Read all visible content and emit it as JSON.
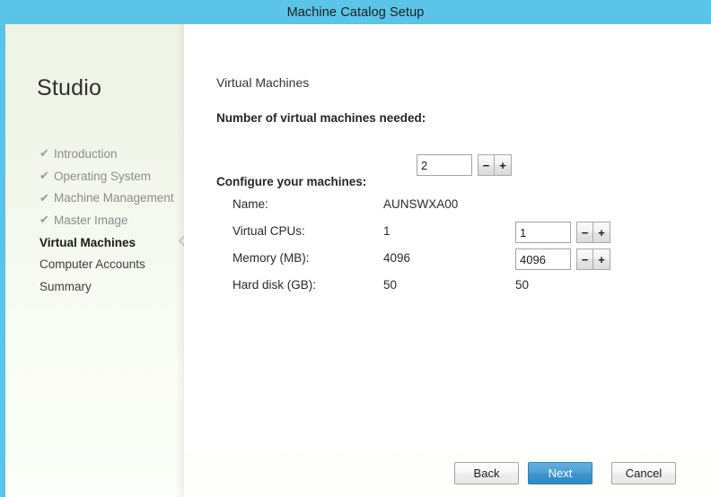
{
  "window": {
    "title": "Machine Catalog Setup"
  },
  "sidebar": {
    "product_title": "Studio",
    "items": [
      {
        "label": "Introduction",
        "state": "done",
        "check": "✔"
      },
      {
        "label": "Operating System",
        "state": "done",
        "check": "✔"
      },
      {
        "label": "Machine Management",
        "state": "done",
        "check": "✔"
      },
      {
        "label": "Master Image",
        "state": "done",
        "check": "✔"
      },
      {
        "label": "Virtual Machines",
        "state": "current",
        "check": ""
      },
      {
        "label": "Computer Accounts",
        "state": "pending",
        "check": ""
      },
      {
        "label": "Summary",
        "state": "pending",
        "check": ""
      }
    ]
  },
  "main": {
    "heading": "Virtual Machines",
    "vm_count": {
      "label": "Number of virtual machines needed:",
      "value": "2",
      "decrement_label": "−",
      "increment_label": "+"
    },
    "configure": {
      "label": "Configure your machines:",
      "rows": [
        {
          "name": "Name:",
          "value": "AUNSWXA00",
          "control": "none",
          "control_value": "",
          "control_text": ""
        },
        {
          "name": "Virtual CPUs:",
          "value": "1",
          "control": "spinner",
          "control_value": "1",
          "control_text": ""
        },
        {
          "name": "Memory (MB):",
          "value": "4096",
          "control": "spinner",
          "control_value": "4096",
          "control_text": ""
        },
        {
          "name": "Hard disk (GB):",
          "value": "50",
          "control": "text",
          "control_value": "",
          "control_text": "50"
        }
      ],
      "decrement_label": "−",
      "increment_label": "+"
    }
  },
  "footer": {
    "back_label": "Back",
    "next_label": "Next",
    "cancel_label": "Cancel"
  },
  "colors": {
    "titlebar": "#5bc4e8",
    "accent_strip": "#5bc4e8",
    "primary_button": "#4ca0d4",
    "sidebar_gradient_top": "#eef3e4",
    "sidebar_gradient_bottom": "#fcfef9"
  }
}
